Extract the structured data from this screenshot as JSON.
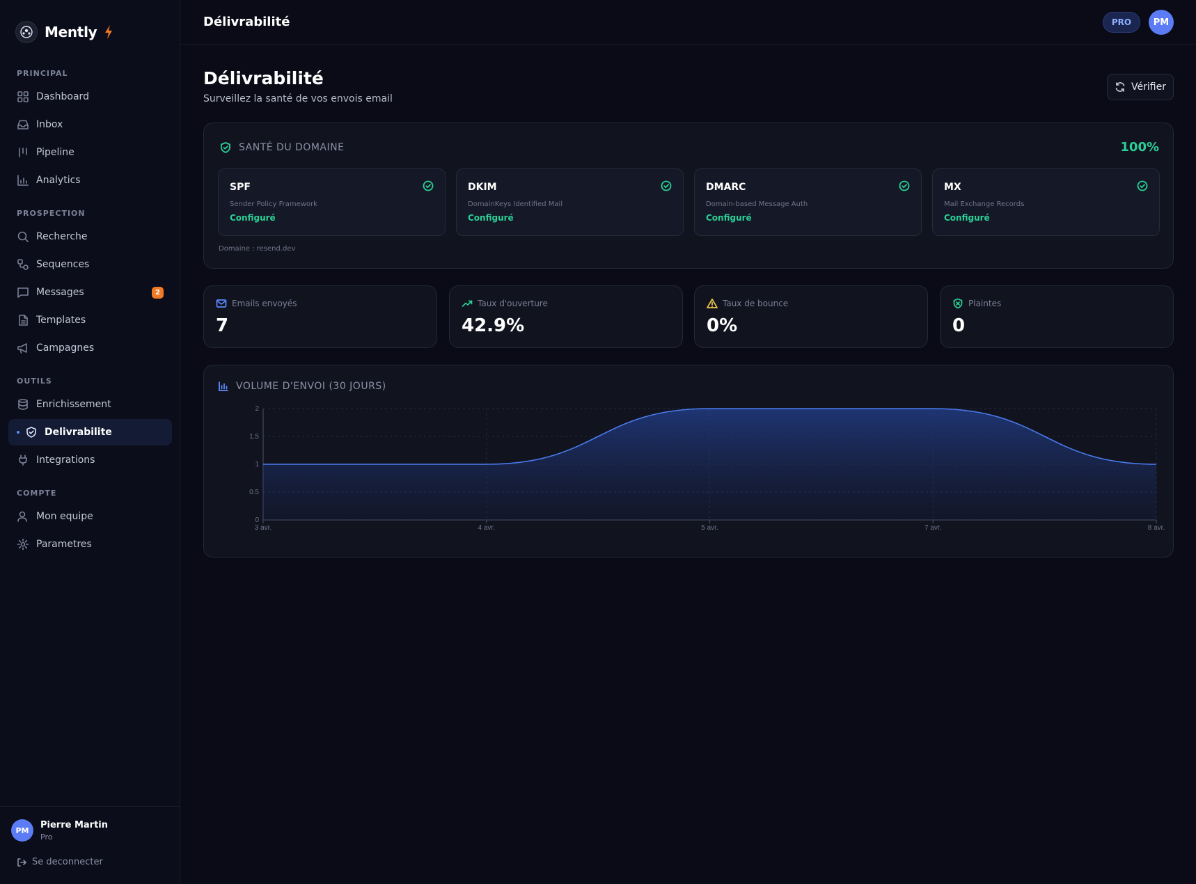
{
  "app": {
    "name": "Mently",
    "page": "Délivrabilité"
  },
  "sidebar": {
    "sections": [
      {
        "label": "PRINCIPAL",
        "items": [
          {
            "label": "Dashboard",
            "icon": "grid-icon"
          },
          {
            "label": "Inbox",
            "icon": "inbox-icon"
          },
          {
            "label": "Pipeline",
            "icon": "pipeline-icon"
          },
          {
            "label": "Analytics",
            "icon": "bar-chart-icon"
          }
        ]
      },
      {
        "label": "PROSPECTION",
        "items": [
          {
            "label": "Recherche",
            "icon": "search-icon"
          },
          {
            "label": "Sequences",
            "icon": "sequence-icon"
          },
          {
            "label": "Messages",
            "icon": "message-icon",
            "badge": "2"
          },
          {
            "label": "Templates",
            "icon": "document-icon"
          },
          {
            "label": "Campagnes",
            "icon": "megaphone-icon"
          }
        ]
      },
      {
        "label": "OUTILS",
        "items": [
          {
            "label": "Enrichissement",
            "icon": "database-icon"
          },
          {
            "label": "Delivrabilite",
            "icon": "shield-icon",
            "active": true
          },
          {
            "label": "Integrations",
            "icon": "plug-icon"
          }
        ]
      },
      {
        "label": "COMPTE",
        "items": [
          {
            "label": "Mon equipe",
            "icon": "users-icon"
          },
          {
            "label": "Parametres",
            "icon": "gear-icon"
          }
        ]
      }
    ],
    "user": {
      "initials": "PM",
      "name": "Pierre Martin",
      "plan": "Pro"
    },
    "logout_label": "Se deconnecter"
  },
  "topbar": {
    "title": "Délivrabilité",
    "plan_badge": "PRO",
    "avatar_initials": "PM"
  },
  "header": {
    "title": "Délivrabilité",
    "subtitle": "Surveillez la santé de vos envois email",
    "verify_label": "Vérifier"
  },
  "health": {
    "title": "SANTÉ DU DOMAINE",
    "score": "100%",
    "records": [
      {
        "name": "SPF",
        "desc": "Sender Policy Framework",
        "status": "Configuré"
      },
      {
        "name": "DKIM",
        "desc": "DomainKeys Identified Mail",
        "status": "Configuré"
      },
      {
        "name": "DMARC",
        "desc": "Domain-based Message Auth",
        "status": "Configuré"
      },
      {
        "name": "MX",
        "desc": "Mail Exchange Records",
        "status": "Configuré"
      }
    ],
    "domain_label": "Domaine : resend.dev"
  },
  "stats": [
    {
      "label": "Emails envoyés",
      "value": "7",
      "icon": "mail-icon",
      "color": "#5b8cff"
    },
    {
      "label": "Taux d'ouverture",
      "value": "42.9%",
      "icon": "trending-up-icon",
      "color": "#2bd096"
    },
    {
      "label": "Taux de bounce",
      "value": "0%",
      "icon": "warning-icon",
      "color": "#f2c94c"
    },
    {
      "label": "Plaintes",
      "value": "0",
      "icon": "shield-x-icon",
      "color": "#2bd096"
    }
  ],
  "colors": {
    "accent": "#5b8cff",
    "success": "#2bd096",
    "warning": "#f2c94c",
    "badge": "#f07a26"
  },
  "chart": {
    "title": "VOLUME D'ENVOI (30 JOURS)"
  },
  "chart_data": {
    "type": "area",
    "x": [
      "3 avr.",
      "4 avr.",
      "5 avr.",
      "7 avr.",
      "8 avr."
    ],
    "values": [
      1,
      1,
      2,
      2,
      1
    ],
    "ylim": [
      0,
      2
    ],
    "yticks": [
      "0",
      "0.5",
      "1",
      "1.5",
      "2"
    ],
    "grid": true,
    "xlabel": "",
    "ylabel": ""
  }
}
